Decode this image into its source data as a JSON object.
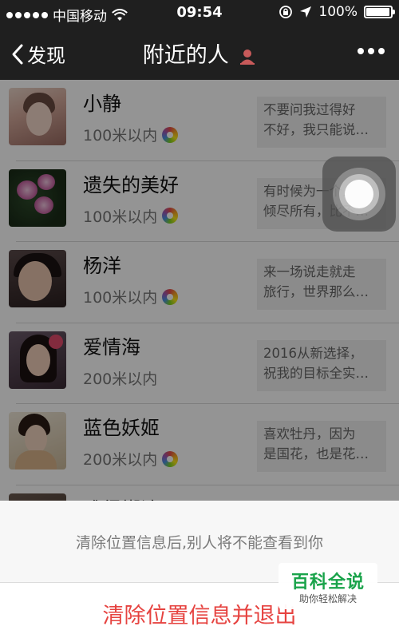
{
  "status_bar": {
    "carrier": "中国移动",
    "time": "09:54",
    "battery": "100%"
  },
  "nav": {
    "back_label": "发现",
    "title": "附近的人"
  },
  "people": [
    {
      "name": "小静",
      "distance": "100米以内",
      "preview": [
        "不要问我过得好",
        "不好，我只能说…"
      ],
      "has_badge": true
    },
    {
      "name": "遗失的美好",
      "distance": "100米以内",
      "preview": [
        "有时候为一个人",
        "倾尽所有，比不…"
      ],
      "has_badge": true
    },
    {
      "name": "杨洋",
      "distance": "100米以内",
      "preview": [
        "来一场说走就走",
        "旅行，世界那么…"
      ],
      "has_badge": true
    },
    {
      "name": "爱情海",
      "distance": "200米以内",
      "preview": [
        "2016从新选择，",
        "祝我的目标全实…"
      ],
      "has_badge": false
    },
    {
      "name": "蓝色妖姬",
      "distance": "200米以内",
      "preview": [
        "喜欢牡丹，因为",
        "是国花，也是花…"
      ],
      "has_badge": true
    },
    {
      "name": "难得糊涂",
      "distance": "",
      "preview": [
        "",
        ""
      ],
      "has_badge": false
    }
  ],
  "sheet": {
    "message": "清除位置信息后,别人将不能查看到你",
    "action_label": "清除位置信息并退出"
  },
  "watermark": {
    "title": "百科全说",
    "subtitle": "助你轻松解决"
  },
  "colors": {
    "nav_bg": "#1f1f1f",
    "destructive": "#e64340",
    "watermark": "#19a34a"
  }
}
